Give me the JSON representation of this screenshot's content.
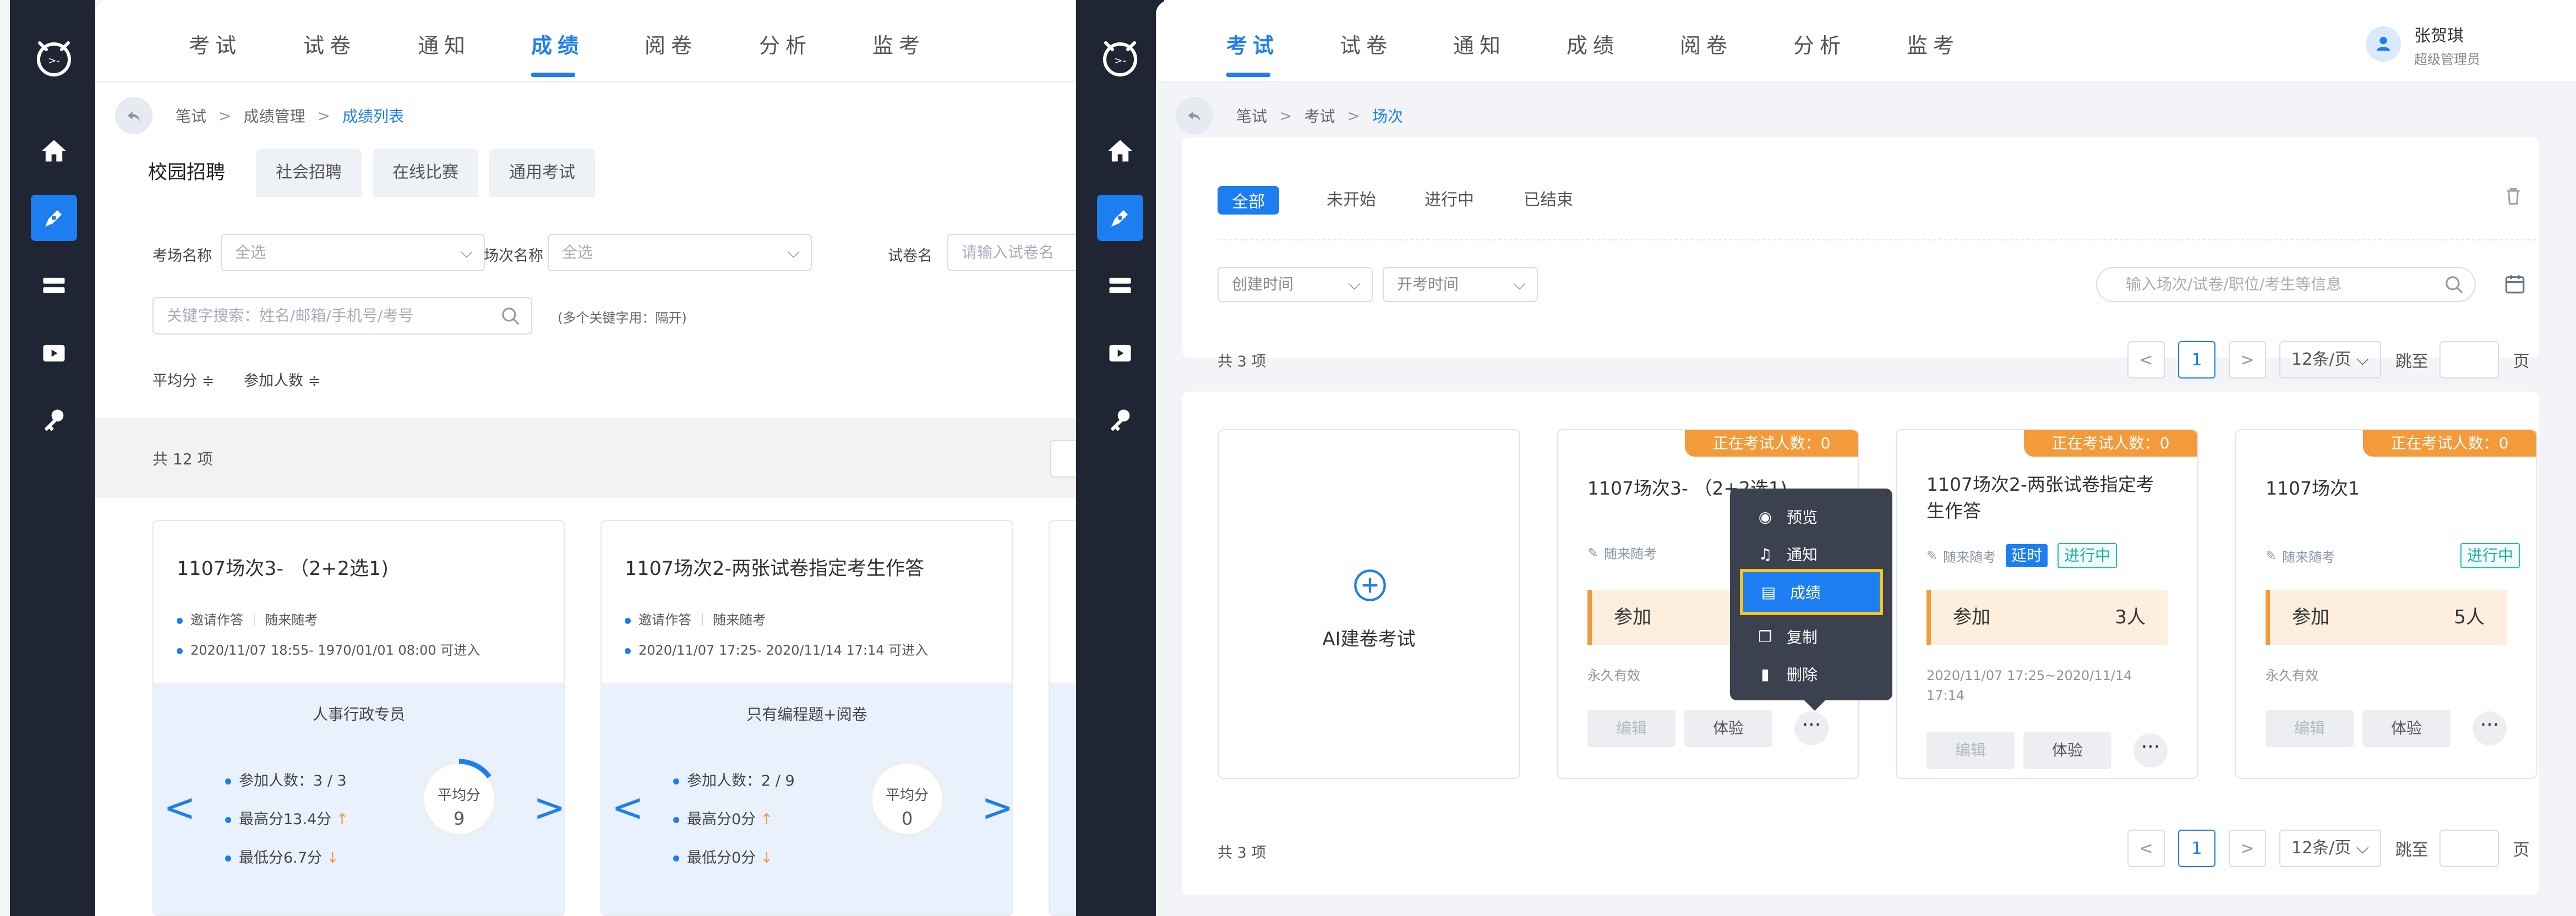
{
  "left": {
    "nav_tabs": [
      "考试",
      "试卷",
      "通知",
      "成绩",
      "阅卷",
      "分析",
      "监考"
    ],
    "active_tab": "成绩",
    "breadcrumb": [
      "笔试",
      "成绩管理",
      "成绩列表"
    ],
    "breadcrumb_sep": ">",
    "sub_tabs": [
      "校园招聘",
      "社会招聘",
      "在线比赛",
      "通用考试"
    ],
    "filters": {
      "exam_room_label": "考场名称",
      "exam_room_value": "全选",
      "session_label": "场次名称",
      "session_value": "全选",
      "paper_label": "试卷名",
      "paper_placeholder": "请输入试卷名",
      "keyword_placeholder": "关键字搜索：姓名/邮箱/手机号/考号",
      "keyword_hint": "(多个关键字用：隔开)",
      "sort_avg": "平均分 ≑",
      "sort_count": "参加人数 ≑"
    },
    "total": "共 12 项",
    "cards": [
      {
        "title": "1107场次3- （2+2选1)",
        "meta1": "邀请作答 ｜ 随来随考",
        "meta2": "2020/11/07 18:55- 1970/01/01 08:00 可进入",
        "role": "人事行政专员",
        "stat1": "参加人数：3 / 3",
        "stat2": "最高分13.4分",
        "stat3": "最低分6.7分",
        "avg_label": "平均分",
        "avg_value": "9",
        "ring_fraction": 0.15
      },
      {
        "title": "1107场次2-两张试卷指定考生作答",
        "meta1": "邀请作答 ｜ 随来随考",
        "meta2": "2020/11/07 17:25- 2020/11/14 17:14 可进入",
        "role": "只有编程题+阅卷",
        "stat1": "参加人数：2 / 9",
        "stat2": "最高分0分",
        "stat3": "最低分0分",
        "avg_label": "平均分",
        "avg_value": "0",
        "ring_fraction": 0
      }
    ]
  },
  "right": {
    "nav_tabs": [
      "考试",
      "试卷",
      "通知",
      "成绩",
      "阅卷",
      "分析",
      "监考"
    ],
    "active_tab": "考试",
    "user": {
      "name": "张贺琪",
      "role": "超级管理员"
    },
    "breadcrumb": [
      "笔试",
      "考试",
      "场次"
    ],
    "breadcrumb_sep": ">",
    "status_filters": [
      "全部",
      "未开始",
      "进行中",
      "已结束"
    ],
    "create_time": "创建时间",
    "start_time": "开考时间",
    "search_placeholder": "输入场次/试卷/职位/考生等信息",
    "total": "共 3 项",
    "page": "1",
    "per_page": "12条/页",
    "jump_label": "跳至",
    "page_unit": "页",
    "create_card_label": "AI建卷考试",
    "cards": [
      {
        "ongoing": "正在考试人数：0",
        "title": "1107场次3- （2+2选1)",
        "mode": "随来随考",
        "join_label": "参加",
        "join_count": "",
        "validity": "永久有效",
        "edit": "编辑",
        "experience": "体验",
        "more": "···"
      },
      {
        "ongoing": "正在考试人数：0",
        "title": "1107场次2-两张试卷指定考生作答",
        "mode": "随来随考",
        "tag_delay": "延时",
        "tag_status": "进行中",
        "join_label": "参加",
        "join_count": "3人",
        "validity": "2020/11/07 17:25~2020/11/14 17:14",
        "edit": "编辑",
        "experience": "体验",
        "more": "···"
      },
      {
        "ongoing": "正在考试人数：0",
        "title": "1107场次1",
        "mode": "随来随考",
        "tag_status": "进行中",
        "join_label": "参加",
        "join_count": "5人",
        "validity": "永久有效",
        "edit": "编辑",
        "experience": "体验",
        "more": "···"
      }
    ],
    "context_menu": [
      "预览",
      "通知",
      "成绩",
      "复制",
      "删除"
    ],
    "context_selected": "成绩"
  },
  "colors": {
    "accent": "#1c7ef0",
    "sidebar": "#1f2532",
    "orange": "#f39a3b",
    "highlight": "#f7c520"
  }
}
